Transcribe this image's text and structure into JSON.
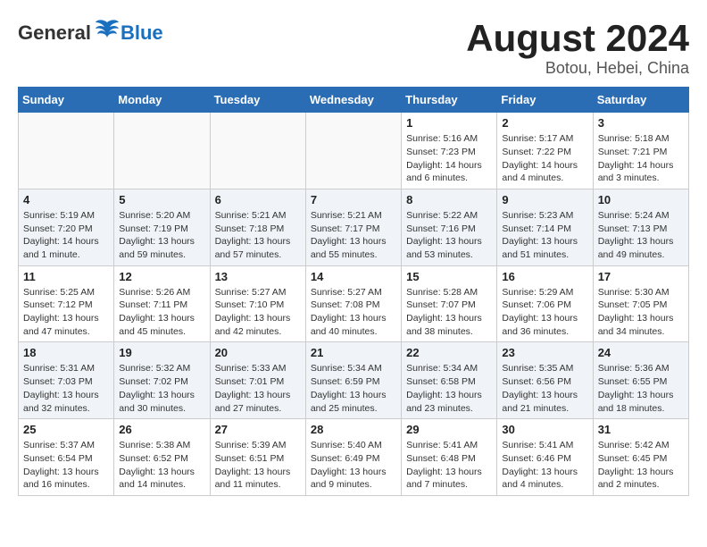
{
  "header": {
    "logo_general": "General",
    "logo_blue": "Blue",
    "month_year": "August 2024",
    "location": "Botou, Hebei, China"
  },
  "days_of_week": [
    "Sunday",
    "Monday",
    "Tuesday",
    "Wednesday",
    "Thursday",
    "Friday",
    "Saturday"
  ],
  "weeks": [
    [
      {
        "day": "",
        "info": ""
      },
      {
        "day": "",
        "info": ""
      },
      {
        "day": "",
        "info": ""
      },
      {
        "day": "",
        "info": ""
      },
      {
        "day": "1",
        "info": "Sunrise: 5:16 AM\nSunset: 7:23 PM\nDaylight: 14 hours\nand 6 minutes."
      },
      {
        "day": "2",
        "info": "Sunrise: 5:17 AM\nSunset: 7:22 PM\nDaylight: 14 hours\nand 4 minutes."
      },
      {
        "day": "3",
        "info": "Sunrise: 5:18 AM\nSunset: 7:21 PM\nDaylight: 14 hours\nand 3 minutes."
      }
    ],
    [
      {
        "day": "4",
        "info": "Sunrise: 5:19 AM\nSunset: 7:20 PM\nDaylight: 14 hours\nand 1 minute."
      },
      {
        "day": "5",
        "info": "Sunrise: 5:20 AM\nSunset: 7:19 PM\nDaylight: 13 hours\nand 59 minutes."
      },
      {
        "day": "6",
        "info": "Sunrise: 5:21 AM\nSunset: 7:18 PM\nDaylight: 13 hours\nand 57 minutes."
      },
      {
        "day": "7",
        "info": "Sunrise: 5:21 AM\nSunset: 7:17 PM\nDaylight: 13 hours\nand 55 minutes."
      },
      {
        "day": "8",
        "info": "Sunrise: 5:22 AM\nSunset: 7:16 PM\nDaylight: 13 hours\nand 53 minutes."
      },
      {
        "day": "9",
        "info": "Sunrise: 5:23 AM\nSunset: 7:14 PM\nDaylight: 13 hours\nand 51 minutes."
      },
      {
        "day": "10",
        "info": "Sunrise: 5:24 AM\nSunset: 7:13 PM\nDaylight: 13 hours\nand 49 minutes."
      }
    ],
    [
      {
        "day": "11",
        "info": "Sunrise: 5:25 AM\nSunset: 7:12 PM\nDaylight: 13 hours\nand 47 minutes."
      },
      {
        "day": "12",
        "info": "Sunrise: 5:26 AM\nSunset: 7:11 PM\nDaylight: 13 hours\nand 45 minutes."
      },
      {
        "day": "13",
        "info": "Sunrise: 5:27 AM\nSunset: 7:10 PM\nDaylight: 13 hours\nand 42 minutes."
      },
      {
        "day": "14",
        "info": "Sunrise: 5:27 AM\nSunset: 7:08 PM\nDaylight: 13 hours\nand 40 minutes."
      },
      {
        "day": "15",
        "info": "Sunrise: 5:28 AM\nSunset: 7:07 PM\nDaylight: 13 hours\nand 38 minutes."
      },
      {
        "day": "16",
        "info": "Sunrise: 5:29 AM\nSunset: 7:06 PM\nDaylight: 13 hours\nand 36 minutes."
      },
      {
        "day": "17",
        "info": "Sunrise: 5:30 AM\nSunset: 7:05 PM\nDaylight: 13 hours\nand 34 minutes."
      }
    ],
    [
      {
        "day": "18",
        "info": "Sunrise: 5:31 AM\nSunset: 7:03 PM\nDaylight: 13 hours\nand 32 minutes."
      },
      {
        "day": "19",
        "info": "Sunrise: 5:32 AM\nSunset: 7:02 PM\nDaylight: 13 hours\nand 30 minutes."
      },
      {
        "day": "20",
        "info": "Sunrise: 5:33 AM\nSunset: 7:01 PM\nDaylight: 13 hours\nand 27 minutes."
      },
      {
        "day": "21",
        "info": "Sunrise: 5:34 AM\nSunset: 6:59 PM\nDaylight: 13 hours\nand 25 minutes."
      },
      {
        "day": "22",
        "info": "Sunrise: 5:34 AM\nSunset: 6:58 PM\nDaylight: 13 hours\nand 23 minutes."
      },
      {
        "day": "23",
        "info": "Sunrise: 5:35 AM\nSunset: 6:56 PM\nDaylight: 13 hours\nand 21 minutes."
      },
      {
        "day": "24",
        "info": "Sunrise: 5:36 AM\nSunset: 6:55 PM\nDaylight: 13 hours\nand 18 minutes."
      }
    ],
    [
      {
        "day": "25",
        "info": "Sunrise: 5:37 AM\nSunset: 6:54 PM\nDaylight: 13 hours\nand 16 minutes."
      },
      {
        "day": "26",
        "info": "Sunrise: 5:38 AM\nSunset: 6:52 PM\nDaylight: 13 hours\nand 14 minutes."
      },
      {
        "day": "27",
        "info": "Sunrise: 5:39 AM\nSunset: 6:51 PM\nDaylight: 13 hours\nand 11 minutes."
      },
      {
        "day": "28",
        "info": "Sunrise: 5:40 AM\nSunset: 6:49 PM\nDaylight: 13 hours\nand 9 minutes."
      },
      {
        "day": "29",
        "info": "Sunrise: 5:41 AM\nSunset: 6:48 PM\nDaylight: 13 hours\nand 7 minutes."
      },
      {
        "day": "30",
        "info": "Sunrise: 5:41 AM\nSunset: 6:46 PM\nDaylight: 13 hours\nand 4 minutes."
      },
      {
        "day": "31",
        "info": "Sunrise: 5:42 AM\nSunset: 6:45 PM\nDaylight: 13 hours\nand 2 minutes."
      }
    ]
  ]
}
